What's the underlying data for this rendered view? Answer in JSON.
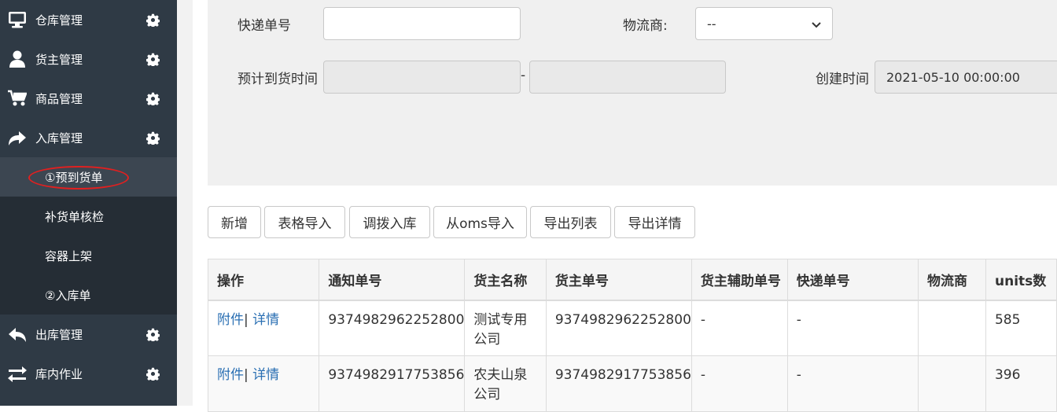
{
  "sidebar": {
    "items": [
      {
        "label": "仓库管理",
        "icon": "monitor-icon"
      },
      {
        "label": "货主管理",
        "icon": "user-icon"
      },
      {
        "label": "商品管理",
        "icon": "cart-icon"
      },
      {
        "label": "入库管理",
        "icon": "share-icon"
      }
    ],
    "sub_items": [
      {
        "label": "①预到货单"
      },
      {
        "label": "补货单核检"
      },
      {
        "label": "容器上架"
      },
      {
        "label": "②入库单"
      }
    ],
    "items_after": [
      {
        "label": "出库管理",
        "icon": "reply-icon"
      },
      {
        "label": "库内作业",
        "icon": "exchange-icon"
      }
    ]
  },
  "search": {
    "tracking_label": "快递单号",
    "tracking_value": "",
    "carrier_label": "物流商:",
    "carrier_value": "--",
    "eta_label": "预计到货时间",
    "eta_from": "",
    "eta_sep": "-",
    "eta_to": "",
    "created_label": "创建时间",
    "created_value": "2021-05-10 00:00:00"
  },
  "toolbar": {
    "new": "新增",
    "import_sheet": "表格导入",
    "transfer_in": "调拨入库",
    "import_oms": "从oms导入",
    "export_list": "导出列表",
    "export_detail": "导出详情"
  },
  "table": {
    "headers": [
      "操作",
      "通知单号",
      "货主名称",
      "货主单号",
      "货主辅助单号",
      "快递单号",
      "物流商",
      "units数"
    ],
    "rows": [
      {
        "attach": "附件",
        "sep": "|",
        "detail": "详情",
        "notice_no": "9374982962252800",
        "owner_line1": "测试专用",
        "owner_line2": "公司",
        "owner_no": "9374982962252800",
        "aux_no": "-",
        "tracking": "-",
        "carrier": "",
        "units": "585"
      },
      {
        "attach": "附件",
        "sep": "|",
        "detail": "详情",
        "notice_no": "9374982917753856",
        "owner_line1": "农夫山泉",
        "owner_line2": "公司",
        "owner_no": "9374982917753856",
        "aux_no": "-",
        "tracking": "-",
        "carrier": "",
        "units": "396"
      }
    ]
  }
}
